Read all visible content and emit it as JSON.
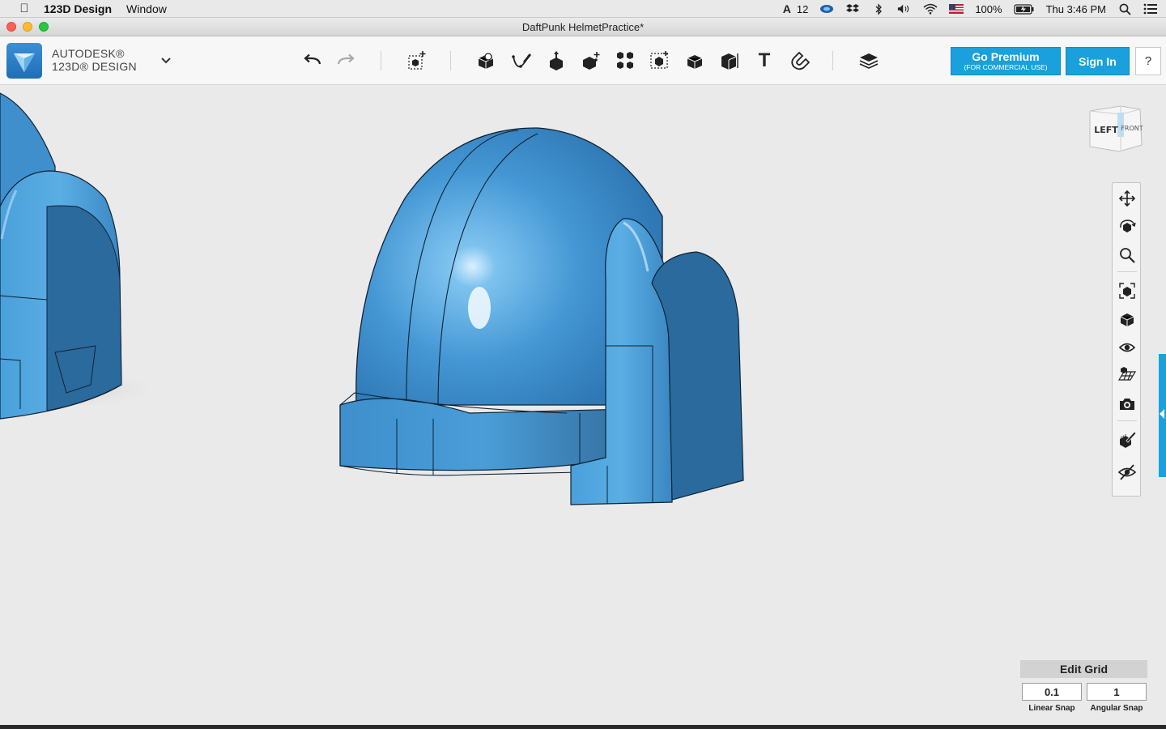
{
  "menubar": {
    "apple_icon": "apple-logo-icon",
    "app_name": "123D Design",
    "menus": [
      "Window"
    ],
    "status": {
      "adobe_count": "12",
      "battery": "100%",
      "clock": "Thu 3:46 PM"
    }
  },
  "window": {
    "title": "DaftPunk HelmetPractice*"
  },
  "toolbar": {
    "brand_line1": "AUTODESK®",
    "brand_line2": "123D® DESIGN",
    "premium_label": "Go Premium",
    "premium_sublabel": "(FOR COMMERCIAL USE)",
    "signin_label": "Sign In",
    "help_label": "?",
    "text_tool_glyph": "T",
    "tools": [
      "undo-icon",
      "redo-icon",
      "transform-icon",
      "primitives-icon",
      "sketch-icon",
      "construct-icon",
      "modify-icon",
      "pattern-icon",
      "grouping-icon",
      "combine-icon",
      "measure-icon",
      "text-icon",
      "snap-icon",
      "material-icon"
    ]
  },
  "viewcube": {
    "face_left": "LEFT",
    "face_front": "FRONT"
  },
  "navbar": {
    "tools": [
      "pan-icon",
      "orbit-icon",
      "zoom-icon",
      "fit-icon",
      "view-mode-icon",
      "visibility-icon",
      "grid-icon",
      "screenshot-icon",
      "material-edit-icon",
      "hide-icon"
    ]
  },
  "edit_grid": {
    "title": "Edit Grid",
    "linear_snap_value": "0.1",
    "linear_snap_label": "Linear Snap",
    "angular_snap_value": "1",
    "angular_snap_label": "Angular Snap"
  },
  "colors": {
    "model_blue": "#4e9fd6",
    "accent": "#1aa0dd",
    "viewport_bg": "#eaeaea"
  }
}
